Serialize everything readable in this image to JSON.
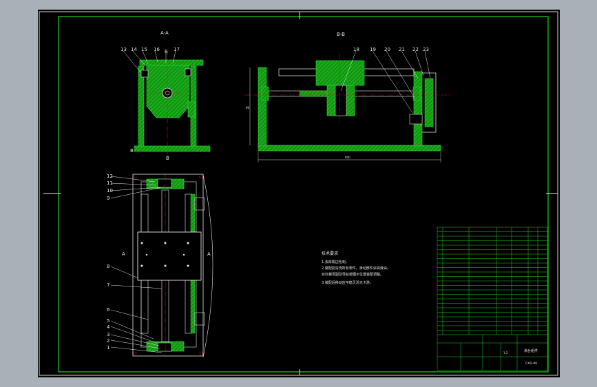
{
  "drawing": {
    "section_aa_label": "A-A",
    "section_bb_label": "B-B",
    "cut_mark_a": "A",
    "cut_mark_b": "B",
    "callouts_aa": [
      "13",
      "14",
      "15",
      "16",
      "8",
      "17"
    ],
    "callouts_bb": [
      "18",
      "19",
      "20",
      "21",
      "22",
      "23"
    ],
    "callouts_plan": [
      "12",
      "11",
      "10",
      "9",
      "8",
      "7",
      "6",
      "5",
      "4",
      "3",
      "2",
      "1"
    ],
    "dim_bb_overall": "000",
    "dim_bb_height": "90"
  },
  "notes": {
    "title": "技术要求",
    "lines": [
      "1.去除锐边毛刺。",
      "2.装配前清洗所有零件，滑动部件涂润滑油。",
      "丝杠螺母副及导轨按图示位置装配调整。",
      "3.装配后移动应平稳灵活无卡滞。"
    ]
  },
  "title_block": {
    "drawing_name": "滑台组件",
    "drawing_code": "CXD-00",
    "scale": "1:2"
  },
  "colors": {
    "screen_bg": "#a9b0b8",
    "sheet_bg": "#000000",
    "frame": "#16d716",
    "text": "#e8e8e8",
    "section_fill": "#17a817",
    "center_line": "#d01414"
  }
}
